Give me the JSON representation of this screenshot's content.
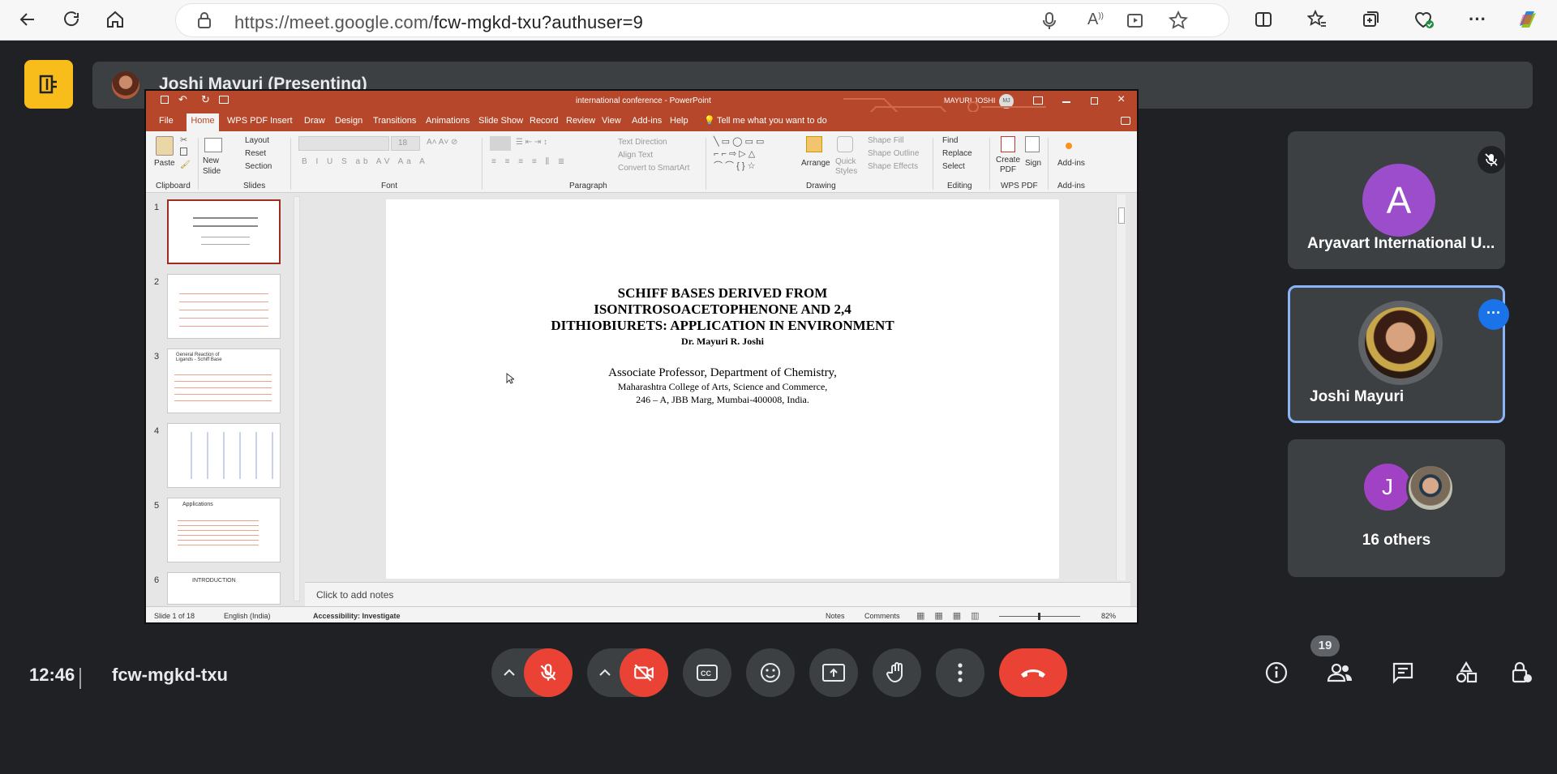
{
  "browser": {
    "url_host": "https://meet.google.com/",
    "url_path": "fcw-mgkd-txu?authuser=9"
  },
  "meet": {
    "presenting_label": "Joshi Mayuri (Presenting)",
    "clock": "12:46",
    "meeting_code": "fcw-mgkd-txu",
    "people_count": "19"
  },
  "ppt": {
    "window_title": "international conference  -  PowerPoint",
    "user_name": "MAYURI JOSHI",
    "user_initials": "MJ",
    "tabs": [
      "File",
      "Home",
      "WPS PDF",
      "Insert",
      "Draw",
      "Design",
      "Transitions",
      "Animations",
      "Slide Show",
      "Record",
      "Review",
      "View",
      "Add-ins",
      "Help"
    ],
    "tell_me": "Tell me what you want to do",
    "ribbon": {
      "paste": "Paste",
      "new_slide": "New Slide",
      "layout": "Layout",
      "reset": "Reset",
      "section": "Section",
      "text_direction": "Text Direction",
      "align_text": "Align Text",
      "convert_smartart": "Convert to SmartArt",
      "arrange": "Arrange",
      "quick_styles": "Quick Styles",
      "shape_fill": "Shape Fill",
      "shape_outline": "Shape Outline",
      "shape_effects": "Shape Effects",
      "find": "Find",
      "replace": "Replace",
      "select": "Select",
      "create_pdf": "Create PDF",
      "sign": "Sign",
      "addins": "Add-ins",
      "font_size": "18",
      "groups": [
        "Clipboard",
        "Slides",
        "Font",
        "Paragraph",
        "Drawing",
        "Editing",
        "WPS PDF",
        "Add-ins"
      ]
    },
    "slide_numbers": [
      "1",
      "2",
      "3",
      "4",
      "5",
      "6"
    ],
    "thumb3_title": "General Reaction of Ligands - Schiff Base",
    "thumb5_title": "Applications",
    "thumb6_title": "INTRODUCTION",
    "slide": {
      "title_line1": "SCHIFF BASES DERIVED FROM",
      "title_line2": "ISONITROSOACETOPHENONE AND 2,4",
      "title_line3": "DITHIOBIURETS: APPLICATION IN ENVIRONMENT",
      "author": "Dr. Mayuri R. Joshi",
      "position": "Associate  Professor, Department of Chemistry,",
      "college": "Maharashtra College of Arts, Science and Commerce,",
      "address": "246 – A, JBB Marg, Mumbai-400008,   India."
    },
    "notes_placeholder": "Click to add notes",
    "status": {
      "slide_of": "Slide 1 of 18",
      "language": "English (India)",
      "accessibility": "Accessibility: Investigate",
      "notes": "Notes",
      "comments": "Comments",
      "zoom": "82%"
    }
  },
  "participants": [
    {
      "initial": "A",
      "name": "Aryavart International U...",
      "color": "#9c4dcc"
    },
    {
      "name": "Joshi Mayuri"
    },
    {
      "initial": "J",
      "name": "16 others",
      "color": "#a142c4"
    }
  ]
}
